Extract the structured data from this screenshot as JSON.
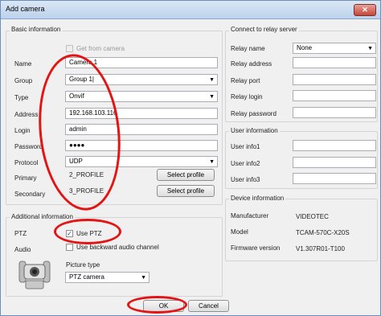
{
  "window": {
    "title": "Add camera",
    "close_label": "✕"
  },
  "basic": {
    "title": "Basic information",
    "get_from_camera": "Get from camera",
    "name_label": "Name",
    "name_value": "Camera 1",
    "group_label": "Group",
    "group_value": "Group 1|",
    "type_label": "Type",
    "type_value": "Onvif",
    "address_label": "Address",
    "address_value": "192.168.103.116",
    "login_label": "Login",
    "login_value": "admin",
    "password_label": "Password",
    "password_value": "●●●●",
    "protocol_label": "Protocol",
    "protocol_value": "UDP",
    "primary_label": "Primary",
    "primary_value": "2_PROFILE",
    "secondary_label": "Secondary",
    "secondary_value": "3_PROFILE",
    "select_profile": "Select profile"
  },
  "additional": {
    "title": "Additional information",
    "ptz_label": "PTZ",
    "use_ptz": "Use PTZ",
    "use_ptz_checked": true,
    "audio_label": "Audio",
    "use_backward": "Use backward audio channel",
    "picture_type_label": "Picture type",
    "picture_type_value": "PTZ camera"
  },
  "relay": {
    "title": "Connect to relay server",
    "relay_name_label": "Relay name",
    "relay_name_value": "None",
    "relay_address_label": "Relay address",
    "relay_port_label": "Relay port",
    "relay_login_label": "Relay login",
    "relay_password_label": "Relay password"
  },
  "user": {
    "title": "User information",
    "info1": "User info1",
    "info2": "User info2",
    "info3": "User info3"
  },
  "device": {
    "title": "Device information",
    "manufacturer_label": "Manufacturer",
    "manufacturer_value": "VIDEOTEC",
    "model_label": "Model",
    "model_value": "TCAM-570C-X20S",
    "firmware_label": "Firmware version",
    "firmware_value": "V1.307R01-T100"
  },
  "buttons": {
    "ok": "OK",
    "cancel": "Cancel"
  },
  "annotation_color": "#e41414"
}
